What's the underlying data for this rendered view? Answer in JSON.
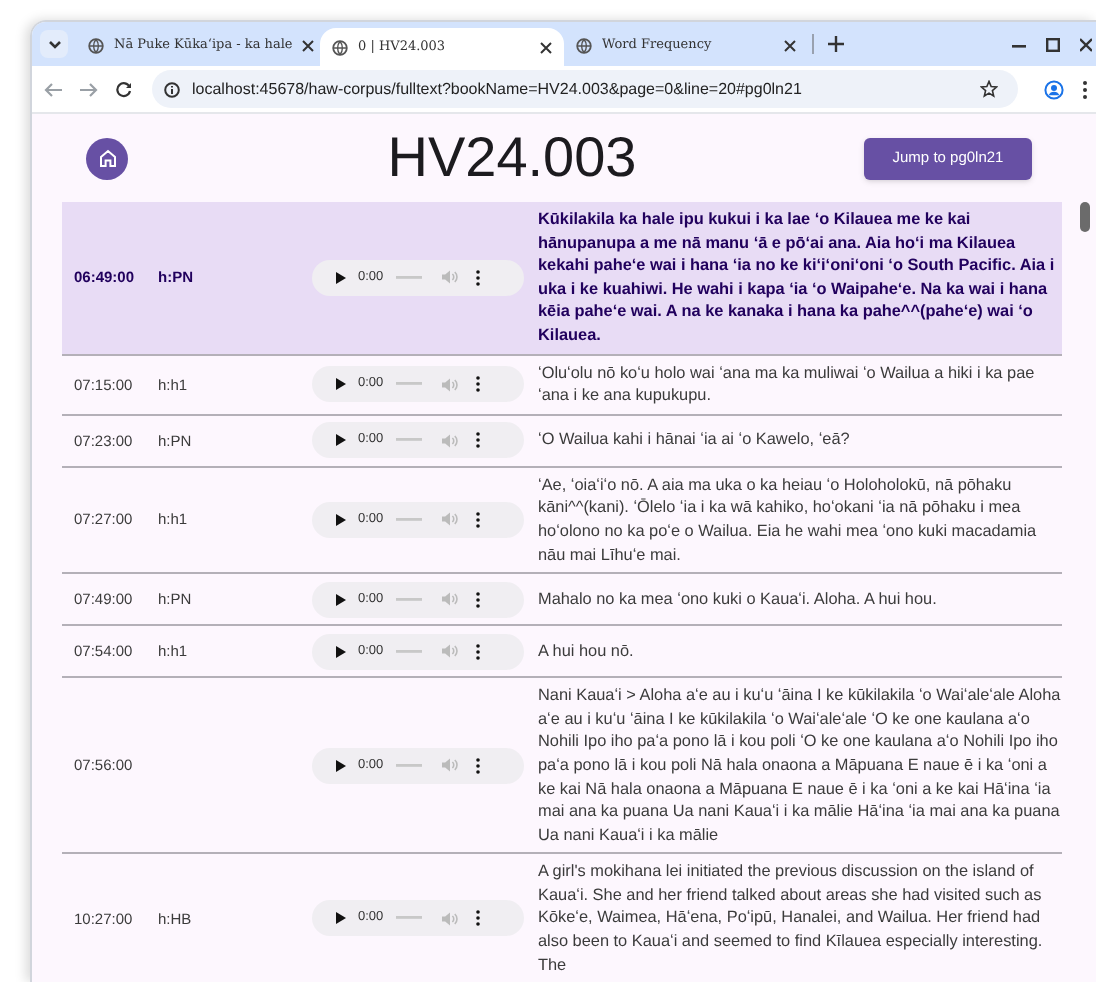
{
  "browser": {
    "tabs": [
      {
        "title": "Nā Puke Kūkaʻipa - ka hale",
        "selected": false
      },
      {
        "title": "0 | HV24.003",
        "selected": true
      },
      {
        "title": "Word Frequency",
        "selected": false
      }
    ],
    "address": "localhost:45678/haw-corpus/fulltext?bookName=HV24.003&page=0&line=20#pg0ln21"
  },
  "page": {
    "title": "HV24.003",
    "jump_button": "Jump to pg0ln21"
  },
  "rows": [
    {
      "time": "06:49:00",
      "speaker": "h:PN",
      "audio_time": "0:00",
      "selected": true,
      "text": "Kūkilakila ka hale ipu kukui i ka lae ʻo Kilauea me ke kai hānupanupa a me nā manu ʻā e pōʻai ana. Aia hoʻi ma Kilauea kekahi paheʻe wai i hana ʻia no ke kiʻiʻoniʻoni ʻo South Pacific. Aia i uka i ke kuahiwi. He wahi i kapa ʻia ʻo Waipaheʻe. Na ka wai i hana kēia paheʻe wai. A na ke kanaka i hana ka pahe^^(paheʻe) wai ʻo Kilauea."
    },
    {
      "time": "07:15:00",
      "speaker": "h:h1",
      "audio_time": "0:00",
      "selected": false,
      "text": "ʻOluʻolu nō koʻu holo wai ʻana ma ka muliwai ʻo Wailua a hiki i ka pae ʻana i ke ana kupukupu."
    },
    {
      "time": "07:23:00",
      "speaker": "h:PN",
      "audio_time": "0:00",
      "selected": false,
      "text": "ʻO Wailua kahi i hānai ʻia ai ʻo Kawelo, ʻeā?"
    },
    {
      "time": "07:27:00",
      "speaker": "h:h1",
      "audio_time": "0:00",
      "selected": false,
      "text": "ʻAe, ʻoiaʻiʻo nō. A aia ma uka o ka heiau ʻo Holoholokū, nā pōhaku kāni^^(kani). ʻŌlelo ʻia i ka wā kahiko, hoʻokani ʻia nā pōhaku i mea hoʻolono no ka poʻe o Wailua. Eia he wahi mea ʻono kuki macadamia nāu mai Līhuʻe mai."
    },
    {
      "time": "07:49:00",
      "speaker": "h:PN",
      "audio_time": "0:00",
      "selected": false,
      "text": "Mahalo no ka mea ʻono kuki o Kauaʻi. Aloha. A hui hou."
    },
    {
      "time": "07:54:00",
      "speaker": "h:h1",
      "audio_time": "0:00",
      "selected": false,
      "text": "A hui hou nō."
    },
    {
      "time": "07:56:00",
      "audio_time": "0:00",
      "selected": false,
      "text": "Nani Kauaʻi > Aloha aʻe au i kuʻu ʻāina I ke kūkilakila ʻo Waiʻaleʻale Aloha aʻe au i kuʻu ʻāina I ke kūkilakila ʻo Waiʻaleʻale ʻO ke one kaulana aʻo Nohili Ipo iho paʻa pono lā i kou poli ʻO ke one kaulana aʻo Nohili Ipo iho paʻa pono lā i kou poli Nā hala onaona a Māpuana E naue ē i ka ʻoni a ke kai Nā hala onaona a Māpuana E naue ē i ka ʻoni a ke kai Hāʻina ʻia mai ana ka puana Ua nani Kauaʻi i ka mālie Hāʻina ʻia mai ana ka puana Ua nani Kauaʻi i ka mālie"
    },
    {
      "time": "10:27:00",
      "speaker": "h:HB",
      "audio_time": "0:00",
      "selected": false,
      "text": "A girl's mokihana lei initiated the previous discussion on the island of Kauaʻi. She and her friend talked about areas she had visited such as Kōkeʻe, Waimea, Hāʻena, Poʻipū, Hanalei, and Wailua. Her friend had also been to Kauaʻi and seemed to find Kīlauea especially interesting. The"
    }
  ]
}
